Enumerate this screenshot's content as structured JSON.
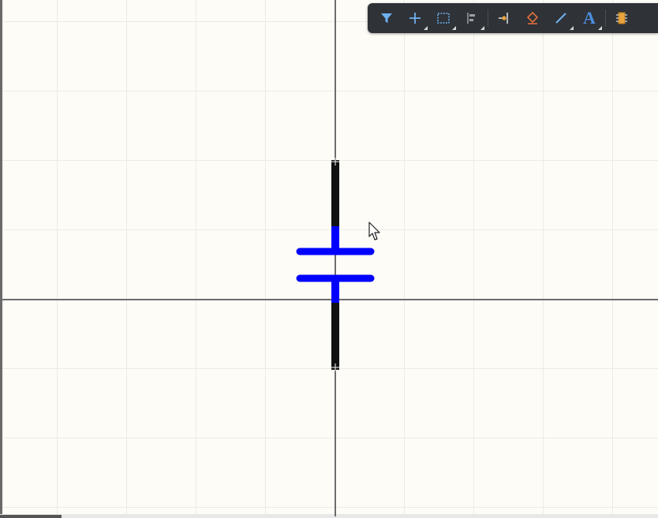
{
  "workspace": {
    "component": "capacitor",
    "colors": {
      "background": "#fdfcf7",
      "grid": "#ecebe3",
      "axis": "#6d6d6d",
      "pin": "#111111",
      "body": "#0000ff"
    }
  },
  "toolbar": {
    "tools": [
      {
        "name": "filter-icon",
        "has_submenu": false
      },
      {
        "name": "crosshair-icon",
        "has_submenu": true
      },
      {
        "name": "select-rectangle-icon",
        "has_submenu": true
      },
      {
        "name": "align-icon",
        "has_submenu": true
      },
      {
        "name": "pin-icon",
        "has_submenu": false
      },
      {
        "name": "eraser-icon",
        "has_submenu": false
      },
      {
        "name": "line-icon",
        "has_submenu": true
      },
      {
        "name": "text-icon",
        "has_submenu": true
      },
      {
        "name": "component-icon",
        "has_submenu": false
      }
    ],
    "text_tool_glyph": "A",
    "accent": "#4a8fe0",
    "eraser_color": "#e2703a",
    "pin_color": "#e8a33c"
  }
}
